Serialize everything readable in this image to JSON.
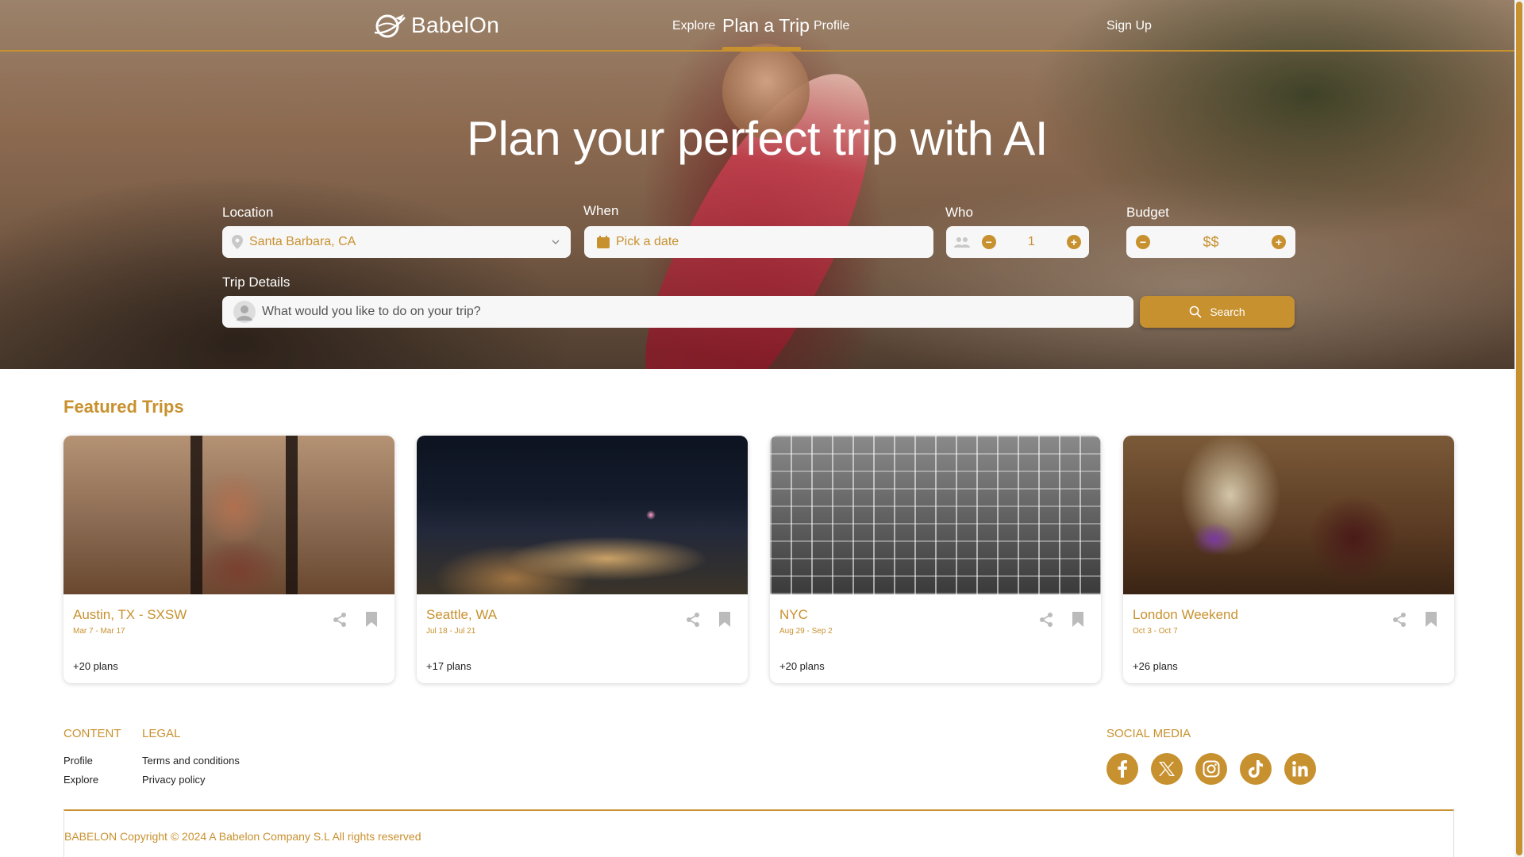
{
  "brand": {
    "name": "BabelOn",
    "accent": "#c8912f"
  },
  "nav": {
    "explore": "Explore",
    "plan_trip": "Plan a Trip",
    "profile": "Profile",
    "sign_up": "Sign Up"
  },
  "hero": {
    "title": "Plan your perfect trip with AI",
    "location": {
      "label": "Location",
      "value": "Santa Barbara, CA"
    },
    "when": {
      "label": "When",
      "placeholder": "Pick a date"
    },
    "who": {
      "label": "Who",
      "value": "1"
    },
    "budget": {
      "label": "Budget",
      "value": "$$"
    },
    "trip_details": {
      "label": "Trip Details",
      "placeholder": "What would you like to do on your trip?"
    },
    "search_label": "Search"
  },
  "featured": {
    "title": "Featured Trips",
    "trips": [
      {
        "title": "Austin, TX - SXSW",
        "dates": "Mar 7 - Mar 17",
        "plans": "+20 plans"
      },
      {
        "title": "Seattle, WA",
        "dates": "Jul 18 - Jul 21",
        "plans": "+17 plans"
      },
      {
        "title": "NYC",
        "dates": "Aug 29 - Sep 2",
        "plans": "+20 plans"
      },
      {
        "title": "London Weekend",
        "dates": "Oct 3 - Oct 7",
        "plans": "+26 plans"
      }
    ]
  },
  "footer": {
    "content": {
      "heading": "CONTENT",
      "links": [
        "Profile",
        "Explore"
      ]
    },
    "legal": {
      "heading": "LEGAL",
      "links": [
        "Terms and conditions",
        "Privacy policy"
      ]
    },
    "social": {
      "heading": "SOCIAL MEDIA",
      "icons": [
        "facebook-icon",
        "x-icon",
        "instagram-icon",
        "tiktok-icon",
        "linkedin-icon"
      ]
    },
    "copyright": "BABELON Copyright © 2024 A Babelon Company S.L All rights reserved"
  }
}
